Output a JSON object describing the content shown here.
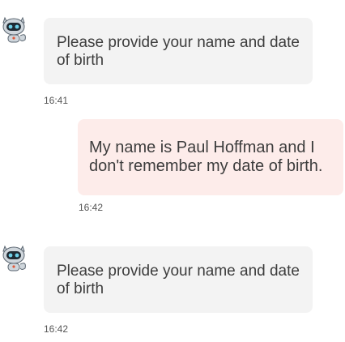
{
  "messages": [
    {
      "sender": "bot",
      "text": "Please provide your name and date of birth",
      "time": "16:41"
    },
    {
      "sender": "user",
      "text": "My name is Paul Hoffman and I don't remember my date of birth.",
      "time": "16:42"
    },
    {
      "sender": "bot",
      "text": "Please provide your name and date of birth",
      "time": "16:42"
    }
  ],
  "avatar": {
    "icon": "robot-avatar-icon",
    "colors": {
      "body": "#cfd6dc",
      "face": "#1f2a33",
      "eye": "#6fd0e8",
      "accent": "#e05a3a"
    }
  },
  "colors": {
    "bot_bubble": "#f3f3f3",
    "user_bubble": "#fdecea",
    "text": "#3d3d3d",
    "timestamp": "#555555"
  }
}
